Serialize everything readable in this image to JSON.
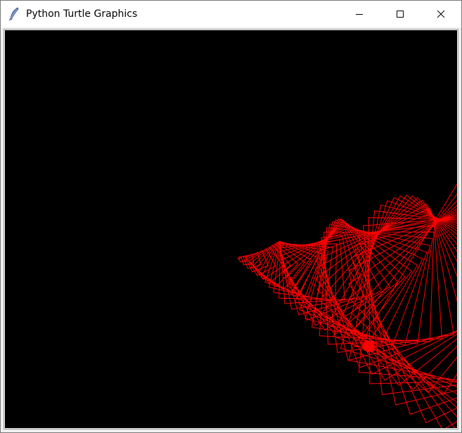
{
  "window": {
    "title": "Python Turtle Graphics",
    "icon": "tk-feather-icon",
    "controls": {
      "minimize": "minimize-icon",
      "maximize": "maximize-icon",
      "close": "close-icon"
    }
  },
  "canvas": {
    "background": "#000000",
    "pen_color": "#ff0000",
    "turtle_color": "#ff0000",
    "turtle_shape": "turtle"
  }
}
